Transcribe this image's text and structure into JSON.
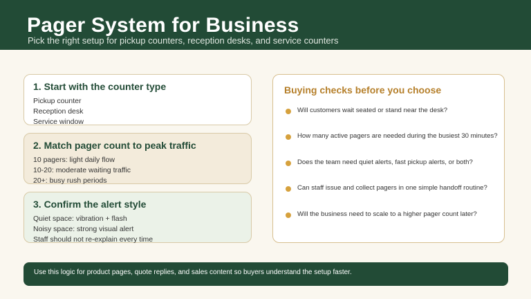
{
  "header": {
    "title": "Pager System for Business",
    "subtitle": "Pick the right setup for pickup counters, reception desks, and service counters"
  },
  "cards": [
    {
      "title": "1. Start with the counter type",
      "lines": [
        "Pickup counter",
        "Reception desk",
        "Service window"
      ]
    },
    {
      "title": "2. Match pager count to peak traffic",
      "lines": [
        "10 pagers: light daily flow",
        "10-20: moderate waiting traffic",
        "20+: busy rush periods"
      ]
    },
    {
      "title": "3. Confirm the alert style",
      "lines": [
        "Quiet space: vibration + flash",
        "Noisy space: strong visual alert",
        "Staff should not re-explain every time"
      ]
    }
  ],
  "checks": {
    "title": "Buying checks before you choose",
    "items": [
      "Will customers wait seated or stand near the desk?",
      "How many active pagers are needed during the busiest 30 minutes?",
      "Does the team need quiet alerts, fast pickup alerts, or both?",
      "Can staff issue and collect pagers in one simple handoff routine?",
      "Will the business need to scale to a higher pager count later?"
    ]
  },
  "footer": {
    "text": "Use this logic for product pages, quote replies, and sales content so buyers understand the setup faster."
  },
  "colors": {
    "brand_green": "#224b36",
    "accent_gold": "#d6a13d",
    "checks_title": "#b57f2a",
    "background": "#faf7ef"
  }
}
